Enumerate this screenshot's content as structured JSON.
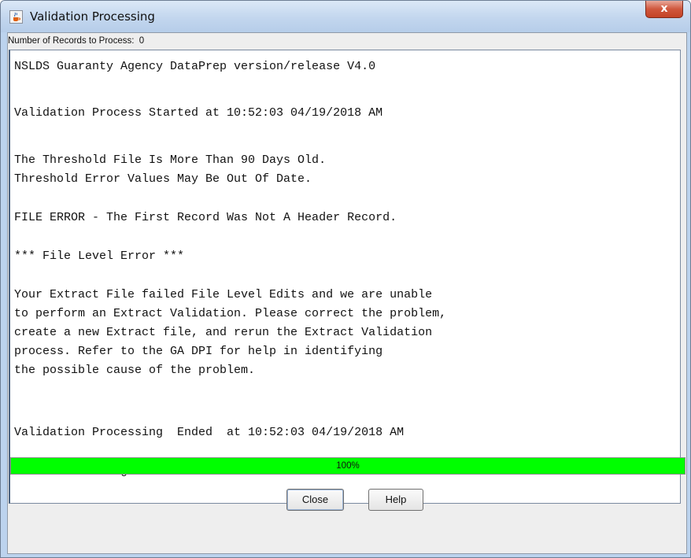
{
  "window": {
    "title": "Validation Processing",
    "close_glyph": "x",
    "icon": "java-cup-icon"
  },
  "status": {
    "records_label": "Number of Records to Process:  0"
  },
  "log": {
    "lines": [
      "NSLDS Guaranty Agency DataPrep version/release V4.0",
      "Validation Process Started at 10:52:03 04/19/2018 AM",
      "The Threshold File Is More Than 90 Days Old.",
      "Threshold Error Values May Be Out Of Date.",
      "FILE ERROR - The First Record Was Not A Header Record.",
      "*** File Level Error ***",
      "Your Extract File failed File Level Edits and we are unable",
      "to perform an Extract Validation. Please correct the problem,",
      "create a new Extract file, and rerun the Extract Validation",
      "process. Refer to the GA DPI for help in identifying",
      "the possible cause of the problem.",
      "Validation Processing  Ended  at 10:52:03 04/19/2018 AM",
      "Total Processing Time 0 hours 0 minutes 1 seconds"
    ]
  },
  "progress": {
    "label": "100%",
    "value": 1.0,
    "color": "#00ff00"
  },
  "buttons": {
    "close_label": "Close",
    "help_label": "Help"
  }
}
